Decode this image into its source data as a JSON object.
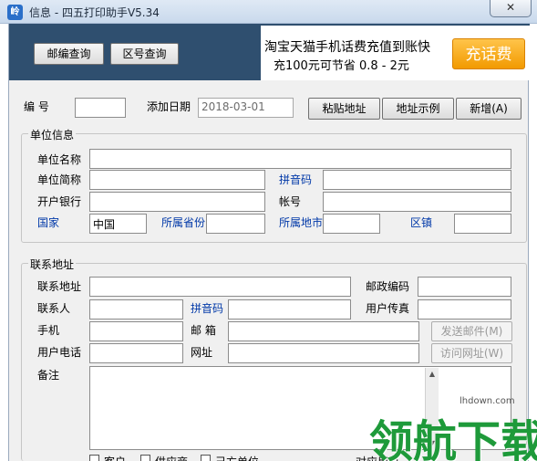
{
  "window": {
    "title": "信息 - 四五打印助手V5.34",
    "app_icon_glyph": "岭",
    "close_glyph": "✕"
  },
  "toolbar": {
    "postcode_query": "邮编查询",
    "area_code_query": "区号查询"
  },
  "ad": {
    "line1": "淘宝天猫手机话费充值到账快",
    "line2": "充100元可节省 0.8 - 2元",
    "button": "充话费"
  },
  "record": {
    "number_label": "编  号",
    "number_value": "",
    "date_label": "添加日期",
    "date_value": "2018-03-01",
    "paste_address": "粘贴地址",
    "address_example": "地址示例",
    "new_button": "新增(A)"
  },
  "unit": {
    "group_title": "单位信息",
    "name_label": "单位名称",
    "short_label": "单位简称",
    "pinyin_label": "拼音码",
    "bank_label": "开户银行",
    "account_label": "帐号",
    "country_label": "国家",
    "country_value": "中国",
    "province_label": "所属省份",
    "city_label": "所属地市",
    "district_label": "区镇"
  },
  "contact": {
    "group_title": "联系地址",
    "address_label": "联系地址",
    "postcode_label": "邮政编码",
    "person_label": "联系人",
    "pinyin_label": "拼音码",
    "fax_label": "用户传真",
    "mobile_label": "手机",
    "email_label": "邮  箱",
    "send_mail": "发送邮件(M)",
    "phone_label": "用户电话",
    "website_label": "网址",
    "visit_site": "访问网址(W)",
    "notes_label": "备注"
  },
  "bottom": {
    "customer": "客户",
    "supplier": "供应商",
    "own_unit": "己方单位",
    "user_label": "对应用户"
  },
  "watermark": {
    "text": "领航下载",
    "url": "lhdown.com"
  },
  "colors": {
    "blue_label": "#0038a8",
    "ad_button": "#f29a00",
    "watermark": "#1e9a3a"
  }
}
